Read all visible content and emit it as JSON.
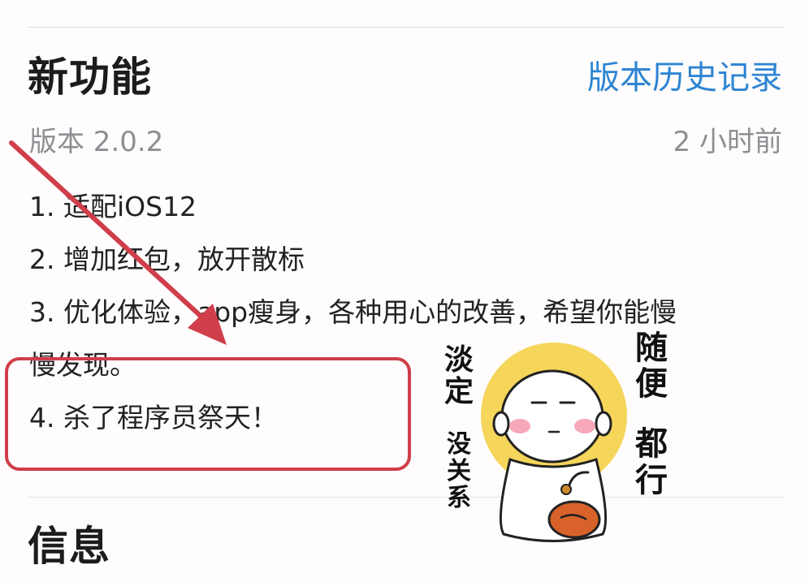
{
  "whats_new": {
    "title": "新功能",
    "history_link": "版本历史记录",
    "version": "版本 2.0.2",
    "time_ago": "2 小时前",
    "notes": [
      "1. 适配iOS12",
      "2. 增加红包，放开散标",
      "3. 优化体验，app瘦身，各种用心的改善，希望你能慢",
      "慢发现。",
      "4. 杀了程序员祭天！"
    ]
  },
  "info": {
    "title": "信息"
  },
  "sticker": {
    "left_top": "淡定",
    "left_bottom": "没关系",
    "right_top": "随便",
    "right_bottom": "都行"
  },
  "colors": {
    "link": "#2d84d3",
    "annotation_red": "#cf3e4a",
    "halo": "#f5d55a"
  }
}
